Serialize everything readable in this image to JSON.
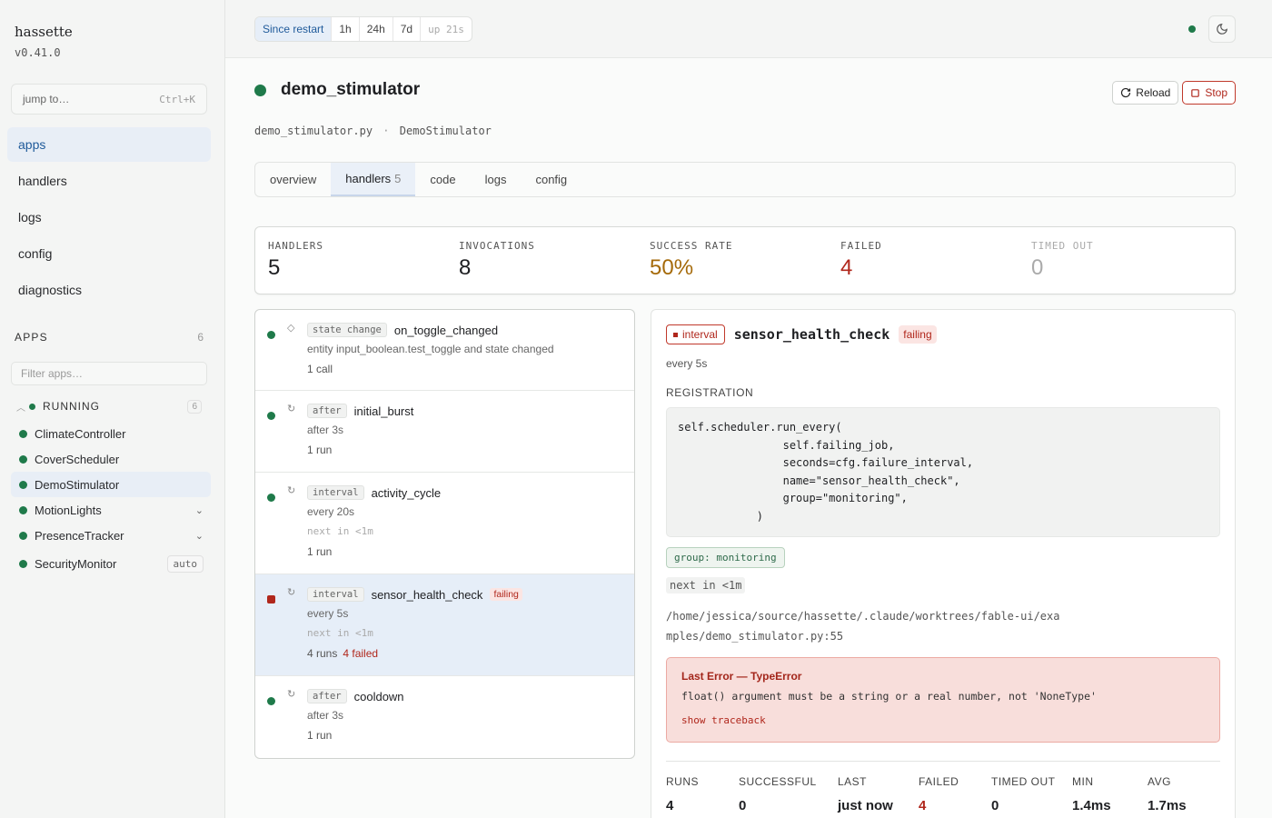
{
  "brand": {
    "name": "hassette",
    "version": "v0.41.0"
  },
  "jump": {
    "placeholder": "jump to…",
    "shortcut": "Ctrl+K"
  },
  "nav": [
    "apps",
    "handlers",
    "logs",
    "config",
    "diagnostics"
  ],
  "apps_section": {
    "title": "APPS",
    "count": "6",
    "filter_placeholder": "Filter apps…"
  },
  "group": {
    "label": "RUNNING",
    "count": "6"
  },
  "apps": [
    {
      "name": "ClimateController",
      "extra": ""
    },
    {
      "name": "CoverScheduler",
      "extra": ""
    },
    {
      "name": "DemoStimulator",
      "extra": ""
    },
    {
      "name": "MotionLights",
      "extra": "chevron"
    },
    {
      "name": "PresenceTracker",
      "extra": "chevron"
    },
    {
      "name": "SecurityMonitor",
      "extra": "auto"
    }
  ],
  "range": {
    "since": "Since restart",
    "h1": "1h",
    "h24": "24h",
    "d7": "7d",
    "uptime": "up 21s"
  },
  "page": {
    "title": "demo_stimulator",
    "file": "demo_stimulator.py",
    "sep": "·",
    "class": "DemoStimulator"
  },
  "actions": {
    "reload": "Reload",
    "stop": "Stop"
  },
  "tabs": {
    "overview": "overview",
    "handlers": "handlers",
    "handlers_count": "5",
    "code": "code",
    "logs": "logs",
    "config": "config"
  },
  "stats": {
    "handlers": {
      "label": "HANDLERS",
      "value": "5"
    },
    "invocations": {
      "label": "INVOCATIONS",
      "value": "8"
    },
    "success": {
      "label": "SUCCESS RATE",
      "value": "50%"
    },
    "failed": {
      "label": "FAILED",
      "value": "4"
    },
    "timed_out": {
      "label": "TIMED OUT",
      "value": "0"
    }
  },
  "handlers": [
    {
      "kind_icon": "◇",
      "type": "state change",
      "name": "on_toggle_changed",
      "sub": "entity input_boolean.test_toggle and state changed",
      "next": "",
      "count": "1 call",
      "failed": "",
      "badge": ""
    },
    {
      "kind_icon": "↻",
      "type": "after",
      "name": "initial_burst",
      "sub": "after 3s",
      "next": "",
      "count": "1 run",
      "failed": "",
      "badge": ""
    },
    {
      "kind_icon": "↻",
      "type": "interval",
      "name": "activity_cycle",
      "sub": "every 20s",
      "next": "next in <1m",
      "count": "1 run",
      "failed": "",
      "badge": ""
    },
    {
      "kind_icon": "↻",
      "type": "interval",
      "name": "sensor_health_check",
      "sub": "every 5s",
      "next": "next in <1m",
      "count": "4 runs",
      "failed": "4 failed",
      "badge": "failing"
    },
    {
      "kind_icon": "↻",
      "type": "after",
      "name": "cooldown",
      "sub": "after 3s",
      "next": "",
      "count": "1 run",
      "failed": "",
      "badge": ""
    }
  ],
  "detail": {
    "tag": "interval",
    "name": "sensor_health_check",
    "badge": "failing",
    "every": "every 5s",
    "registration_label": "REGISTRATION",
    "code": "self.scheduler.run_every(\n                self.failing_job,\n                seconds=cfg.failure_interval,\n                name=\"sensor_health_check\",\n                group=\"monitoring\",\n            )",
    "group": "group: monitoring",
    "next": "next in <1m",
    "path": "/home/jessica/source/hassette/.claude/worktrees/fable-ui/examples/demo_stimulator.py:55",
    "error_title": "Last Error — TypeError",
    "error_msg": "float() argument must be a string or a real number, not 'NoneType'",
    "traceback": "show traceback",
    "metrics": [
      {
        "label": "RUNS",
        "value": "4"
      },
      {
        "label": "SUCCESSFUL",
        "value": "0"
      },
      {
        "label": "LAST",
        "value": "just now"
      },
      {
        "label": "FAILED",
        "value": "4"
      },
      {
        "label": "TIMED OUT",
        "value": "0"
      },
      {
        "label": "MIN",
        "value": "1.4ms"
      },
      {
        "label": "AVG",
        "value": "1.7ms"
      }
    ]
  },
  "colors": {
    "ok": "#1f7a4a",
    "fail": "#b0271c",
    "accent": "#1f5a9a",
    "warn": "#a56a0a"
  }
}
